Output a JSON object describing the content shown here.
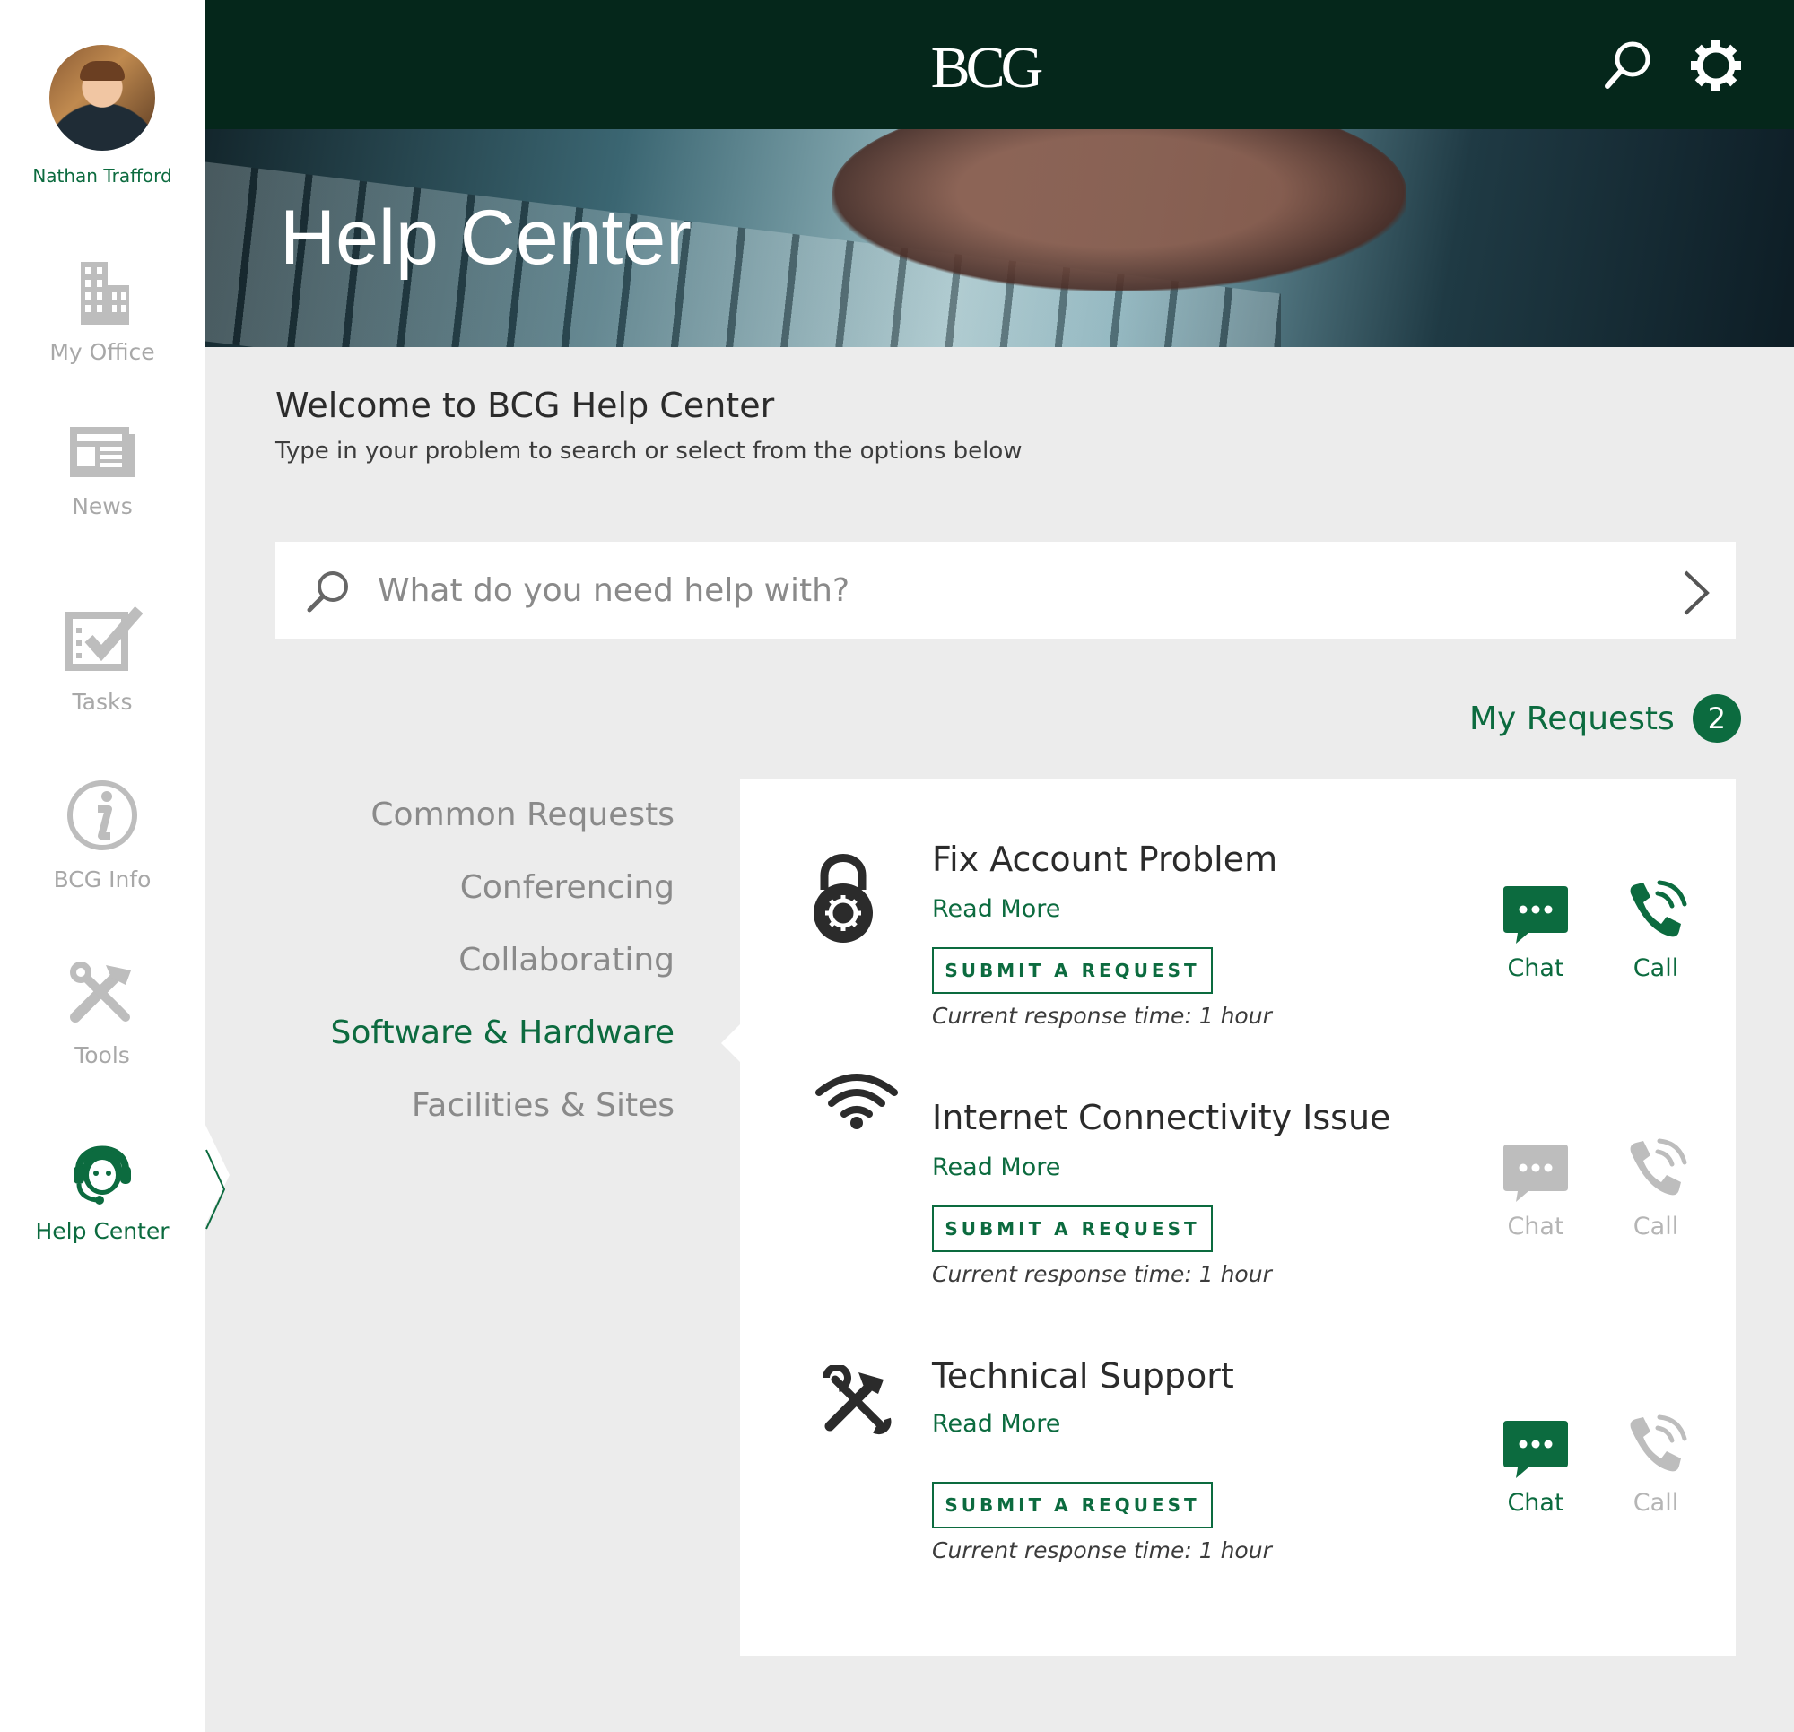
{
  "user": {
    "name": "Nathan Trafford"
  },
  "sidebar": {
    "items": [
      {
        "label": "My Office",
        "icon": "building-icon"
      },
      {
        "label": "News",
        "icon": "newspaper-icon"
      },
      {
        "label": "Tasks",
        "icon": "checklist-icon"
      },
      {
        "label": "BCG Info",
        "icon": "info-icon"
      },
      {
        "label": "Tools",
        "icon": "tools-icon"
      },
      {
        "label": "Help Center",
        "icon": "support-agent-icon",
        "active": true
      }
    ]
  },
  "header": {
    "logo": "BCG",
    "icons": [
      "search-icon",
      "gear-icon"
    ]
  },
  "hero": {
    "title": "Help Center"
  },
  "welcome": {
    "title": "Welcome to BCG Help Center",
    "subtitle": "Type in your problem to search or select from the options below"
  },
  "search": {
    "placeholder": "What do you need help with?"
  },
  "my_requests": {
    "label": "My Requests",
    "count": "2"
  },
  "categories": [
    {
      "label": "Common Requests"
    },
    {
      "label": "Conferencing"
    },
    {
      "label": "Collaborating"
    },
    {
      "label": "Software & Hardware",
      "active": true
    },
    {
      "label": "Facilities & Sites"
    }
  ],
  "requests": [
    {
      "title": "Fix Account Problem",
      "read_more": "Read More",
      "submit": "SUBMIT A REQUEST",
      "response": "Current response time: 1 hour",
      "icon": "padlock-gear-icon",
      "chat": "Chat",
      "call": "Call",
      "chat_enabled": true,
      "call_enabled": true
    },
    {
      "title": "Internet Connectivity Issue",
      "read_more": "Read More",
      "submit": "SUBMIT A REQUEST",
      "response": "Current response time: 1 hour",
      "icon": "wifi-icon",
      "chat": "Chat",
      "call": "Call",
      "chat_enabled": false,
      "call_enabled": false
    },
    {
      "title": "Technical Support",
      "read_more": "Read More",
      "submit": "SUBMIT A REQUEST",
      "response": "Current response time: 1 hour",
      "icon": "tools-icon",
      "chat": "Chat",
      "call": "Call",
      "chat_enabled": true,
      "call_enabled": false
    }
  ],
  "colors": {
    "brand_green": "#0c6b3f",
    "header_dark": "#05271b",
    "inactive_gray": "#b5b5b5",
    "background": "#ececec"
  }
}
